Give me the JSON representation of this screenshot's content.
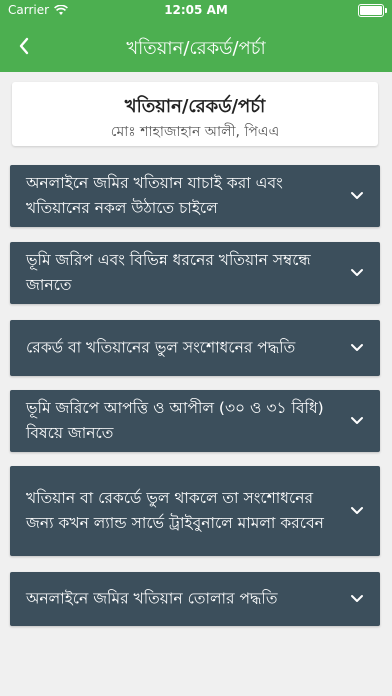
{
  "status_bar": {
    "carrier": "Carrier",
    "time": "12:05 AM"
  },
  "nav": {
    "title": "খতিয়ান/রেকর্ড/পর্চা",
    "back_icon": "chevron-left-icon"
  },
  "header": {
    "title": "খতিয়ান/রেকর্ড/পর্চা",
    "subtitle": "মোঃ শাহাজাহান আলী, পিএএ"
  },
  "sections": [
    {
      "label": "অনলাইনে জমির খতিয়ান যাচাই করা এবং খতিয়ানের নকল উঠাতে চাইলে"
    },
    {
      "label": "ভূমি জরিপ এবং বিভিন্ন ধরনের খতিয়ান সম্বন্ধে জানতে"
    },
    {
      "label": "রেকর্ড বা খতিয়ানের ভুল সংশোধনের পদ্ধতি"
    },
    {
      "label": "ভূমি জরিপে আপত্তি ও আপীল (৩০ ও ৩১ বিধি) বিষয়ে জানতে"
    },
    {
      "label": "খতিয়ান বা রেকর্ডে ভুল থাকলে তা সংশোধনের জন্য কখন ল্যান্ড সার্ভে ট্রাইবুনালে মামলা করবেন"
    },
    {
      "label": "অনলাইনে জমির খতিয়ান তোলার পদ্ধতি"
    }
  ],
  "colors": {
    "primary": "#4caf50",
    "accordion_bg": "#3c4f5c",
    "page_bg": "#f0f0f0"
  }
}
